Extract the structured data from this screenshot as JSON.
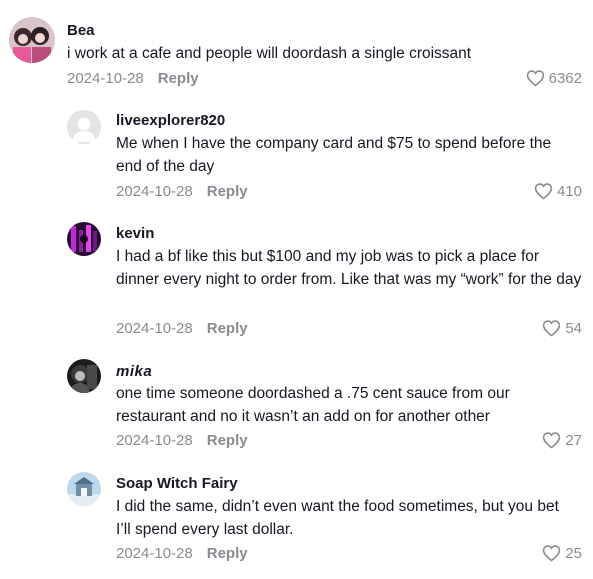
{
  "comments": [
    {
      "username": "Bea",
      "avatar_icon": "avatar-bea",
      "text": "i work at a cafe and people will doordash a single croissant",
      "date": "2024-10-28",
      "reply_label": "Reply",
      "likes": "6362",
      "level": "top"
    },
    {
      "username": "liveexplorer820",
      "avatar_icon": "default-avatar",
      "text": "Me when I have the company card and $75 to spend before the end of the day",
      "date": "2024-10-28",
      "reply_label": "Reply",
      "likes": "410",
      "level": "reply"
    },
    {
      "username": "kevin",
      "avatar_icon": "avatar-kevin",
      "text": "I had a bf like this but $100 and my job was to pick a place for dinner every night to order from. Like that was my “work” for the day",
      "date": "2024-10-28",
      "reply_label": "Reply",
      "likes": "54",
      "level": "reply"
    },
    {
      "username": "mika",
      "avatar_icon": "avatar-mika",
      "text": "one time someone doordashed a .75 cent sauce from our restaurant and no it wasn’t an add on for another other",
      "date": "2024-10-28",
      "reply_label": "Reply",
      "likes": "27",
      "level": "reply"
    },
    {
      "username": "Soap Witch Fairy",
      "avatar_icon": "avatar-soap-witch-fairy",
      "text": "I did the same, didn’t even want the food sometimes, but you bet I’ll spend every last dollar.",
      "date": "2024-10-28",
      "reply_label": "Reply",
      "likes": "25",
      "level": "reply"
    }
  ],
  "colors": {
    "text": "#161823",
    "muted": "#8a8b91"
  }
}
